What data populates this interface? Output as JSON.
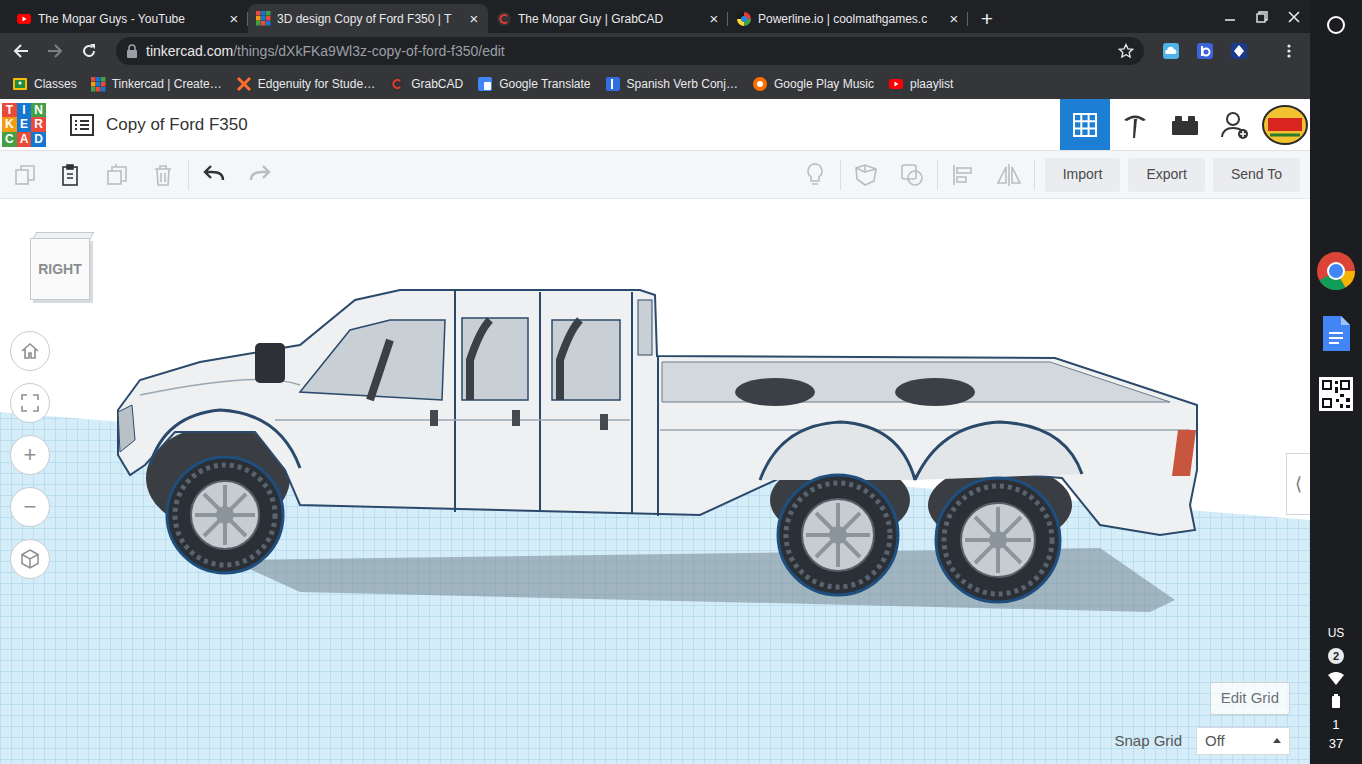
{
  "browser": {
    "tabs": [
      {
        "label": "The Mopar Guys - YouTube",
        "selected": false,
        "close": "×"
      },
      {
        "label": "3D design Copy of Ford F350 | T",
        "selected": true,
        "close": "×"
      },
      {
        "label": "The Mopar Guy | GrabCAD",
        "selected": false,
        "close": "×"
      },
      {
        "label": "Powerline.io | coolmathgames.c",
        "selected": false,
        "close": "×"
      }
    ],
    "new_tab": "+",
    "url": {
      "host": "tinkercad.com",
      "path": "/things/dXkFKa9Wl3z-copy-of-ford-f350/edit"
    },
    "bookmarks": [
      "Classes",
      "Tinkercad | Create…",
      "Edgenuity for Stude…",
      "GrabCAD",
      "Google Translate",
      "Spanish Verb Conj…",
      "Google Play Music",
      "plaaylist"
    ]
  },
  "app": {
    "logo": [
      {
        "letter": "T",
        "color": "#e84a3c"
      },
      {
        "letter": "I",
        "color": "#1477d1"
      },
      {
        "letter": "N",
        "color": "#43a047"
      },
      {
        "letter": "K",
        "color": "#f39c12"
      },
      {
        "letter": "E",
        "color": "#1477d1"
      },
      {
        "letter": "R",
        "color": "#e84a3c"
      },
      {
        "letter": "C",
        "color": "#43a047"
      },
      {
        "letter": "A",
        "color": "#e84a3c"
      },
      {
        "letter": "D",
        "color": "#1477d1"
      }
    ],
    "title": "Copy of Ford F350",
    "views": [
      {
        "selected": true
      },
      {
        "selected": false
      },
      {
        "selected": false
      }
    ],
    "toolbar": {
      "left": [
        {
          "enabled": false
        },
        {
          "enabled": true
        },
        {
          "enabled": false
        },
        {
          "enabled": false
        },
        {
          "enabled": true
        },
        {
          "enabled": false
        }
      ],
      "right": [
        {
          "enabled": false
        },
        {
          "enabled": false
        },
        {
          "enabled": false
        },
        {
          "enabled": false
        },
        {
          "enabled": false
        }
      ],
      "buttons": [
        "Import",
        "Export",
        "Send To"
      ]
    }
  },
  "workplane": {
    "view_cube": "RIGHT",
    "zoom_in": "+",
    "zoom_out": "−",
    "panel_toggle": "⟨",
    "edit_grid": "Edit Grid",
    "snap_grid": {
      "label": "Snap Grid",
      "value": "Off"
    }
  },
  "shelf": {
    "input": "US",
    "notifications": "2",
    "clock": {
      "hour": "1",
      "minute": "37"
    }
  }
}
